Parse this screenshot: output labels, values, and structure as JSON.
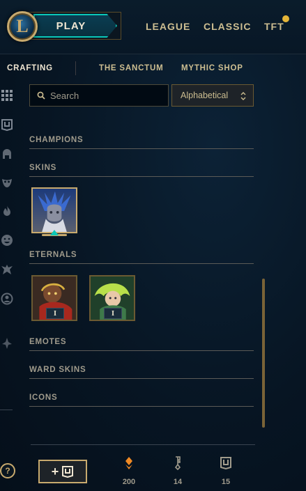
{
  "header": {
    "logo_letter": "L",
    "play_label": "PLAY",
    "nav": [
      "LEAGUE",
      "CLASSIC",
      "TFT"
    ],
    "notification": true
  },
  "subnav": {
    "tabs": [
      "CRAFTING",
      "THE SANCTUM",
      "MYTHIC SHOP"
    ],
    "active": "CRAFTING"
  },
  "rail": {
    "icons": [
      "grid-icon",
      "chest-icon",
      "helmet-icon",
      "mask-icon",
      "fire-icon",
      "emote-icon",
      "ward-icon",
      "profile-icon",
      "crest-icon"
    ]
  },
  "search": {
    "placeholder": "Search",
    "value": ""
  },
  "sort": {
    "selected": "Alphabetical"
  },
  "sections": {
    "champions": "CHAMPIONS",
    "skins": "SKINS",
    "eternals": "ETERNALS",
    "emotes": "EMOTES",
    "ward_skins": "WARD SKINS",
    "icons": "ICONS"
  },
  "eternals": [
    {
      "badge": "I"
    },
    {
      "badge": "I"
    }
  ],
  "footer": {
    "help": "?",
    "add_label": "+",
    "currencies": [
      {
        "icon": "essence-icon",
        "value": "200"
      },
      {
        "icon": "key-icon",
        "value": "14"
      },
      {
        "icon": "chest-icon",
        "value": "15"
      }
    ]
  },
  "colors": {
    "accent_gold": "#c8aa6e",
    "accent_teal": "#0ac8b9",
    "background": "#071523",
    "notification": "#e5b538"
  }
}
